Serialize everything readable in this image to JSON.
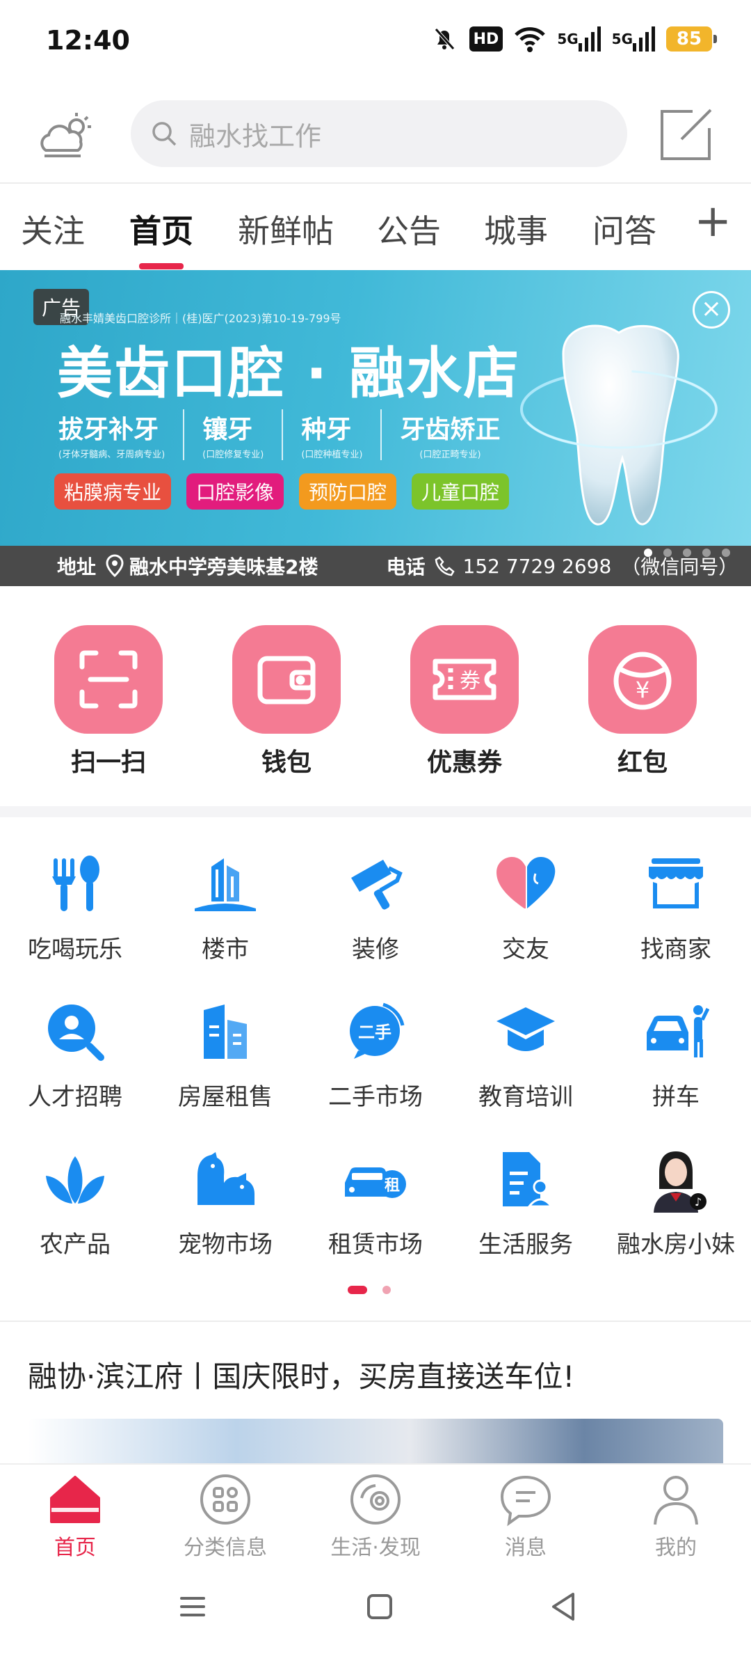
{
  "status_bar": {
    "time": "12:40",
    "hd_label": "HD",
    "signal1": "5G",
    "signal2": "5G",
    "battery": "85"
  },
  "header": {
    "search_placeholder": "融水找工作"
  },
  "tabs": [
    {
      "label": "关注"
    },
    {
      "label": "首页"
    },
    {
      "label": "新鲜帖"
    },
    {
      "label": "公告"
    },
    {
      "label": "城事"
    },
    {
      "label": "问答"
    }
  ],
  "tabs_plus": "+",
  "banner": {
    "badge": "广告",
    "subtitle": "融水丰婧美齿口腔诊所｜(桂)医广(2023)第10-19-799号",
    "title": "美齿口腔 · 融水店",
    "services": [
      {
        "name": "拔牙补牙",
        "desc": "(牙体牙髓病、牙周病专业)"
      },
      {
        "name": "镶牙",
        "desc": "(口腔修复专业)"
      },
      {
        "name": "种牙",
        "desc": "(口腔种植专业)"
      },
      {
        "name": "牙齿矫正",
        "desc": "(口腔正畸专业)"
      }
    ],
    "tags": [
      {
        "label": "粘膜病专业",
        "color": "#e8503f"
      },
      {
        "label": "口腔影像",
        "color": "#e21c7d"
      },
      {
        "label": "预防口腔",
        "color": "#f39a1e"
      },
      {
        "label": "儿童口腔",
        "color": "#7cc42a"
      }
    ],
    "address_label": "地址",
    "address": "融水中学旁美味基2楼",
    "phone_label": "电话",
    "phone": "152 7729 2698",
    "phone_note": "（微信同号）",
    "close_symbol": "×"
  },
  "quick_actions": [
    {
      "label": "扫一扫",
      "icon": "scan-icon"
    },
    {
      "label": "钱包",
      "icon": "wallet-icon"
    },
    {
      "label": "优惠券",
      "icon": "coupon-icon"
    },
    {
      "label": "红包",
      "icon": "red-packet-icon"
    }
  ],
  "coupon_char": "券",
  "yen_char": "¥",
  "categories": [
    {
      "label": "吃喝玩乐",
      "icon": "fork-spoon-icon"
    },
    {
      "label": "楼市",
      "icon": "building-icon"
    },
    {
      "label": "装修",
      "icon": "paint-roller-icon"
    },
    {
      "label": "交友",
      "icon": "heart-face-icon"
    },
    {
      "label": "找商家",
      "icon": "store-icon"
    },
    {
      "label": "人才招聘",
      "icon": "recruit-icon"
    },
    {
      "label": "房屋租售",
      "icon": "house-rent-icon"
    },
    {
      "label": "二手市场",
      "icon": "second-hand-icon"
    },
    {
      "label": "教育培训",
      "icon": "graduation-cap-icon"
    },
    {
      "label": "拼车",
      "icon": "carpool-icon"
    },
    {
      "label": "农产品",
      "icon": "leaf-icon"
    },
    {
      "label": "宠物市场",
      "icon": "pet-icon"
    },
    {
      "label": "租赁市场",
      "icon": "car-rental-icon"
    },
    {
      "label": "生活服务",
      "icon": "life-service-icon"
    },
    {
      "label": "融水房小妹",
      "icon": "avatar-icon"
    }
  ],
  "second_hand_text": "二手",
  "rent_char": "租",
  "article": {
    "title": "融协·滨江府丨国庆限时，买房直接送车位!"
  },
  "bottom_nav": [
    {
      "label": "首页",
      "icon": "home-icon",
      "active": true
    },
    {
      "label": "分类信息",
      "icon": "category-icon",
      "active": false
    },
    {
      "label": "生活·发现",
      "icon": "discover-icon",
      "active": false
    },
    {
      "label": "消息",
      "icon": "message-icon",
      "active": false
    },
    {
      "label": "我的",
      "icon": "profile-icon",
      "active": false
    }
  ],
  "colors": {
    "accent": "#e7264a",
    "quick_action_bg": "#f47b93",
    "category_blue": "#1a8cf0"
  }
}
